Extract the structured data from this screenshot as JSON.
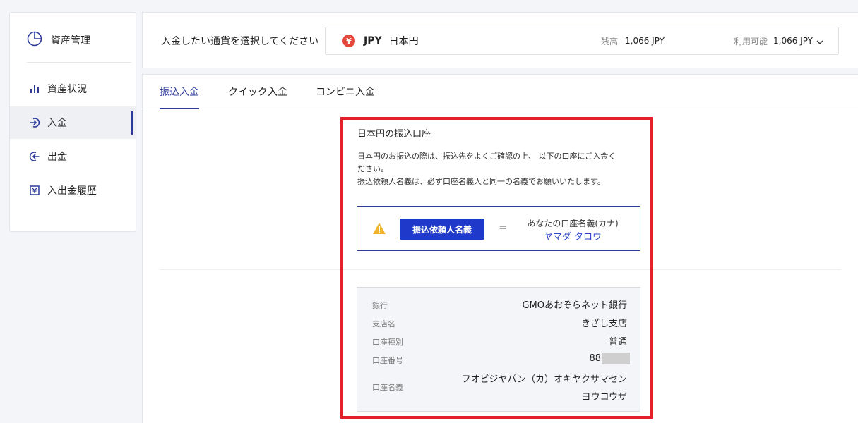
{
  "sidebar": {
    "title": "資産管理",
    "items": [
      {
        "label": "資産状況"
      },
      {
        "label": "入金"
      },
      {
        "label": "出金"
      },
      {
        "label": "入出金履歴"
      }
    ]
  },
  "currency": {
    "prompt": "入金したい通貨を選択してください",
    "badge": "¥",
    "code": "JPY",
    "name": "日本円",
    "balance_label": "残高",
    "balance_value": "1,066 JPY",
    "available_label": "利用可能",
    "available_value": "1,066 JPY"
  },
  "tabs": [
    {
      "label": "振込入金"
    },
    {
      "label": "クイック入金"
    },
    {
      "label": "コンビニ入金"
    }
  ],
  "deposit": {
    "title": "日本円の振込口座",
    "desc_line1": "日本円のお振込の際は、振込先をよくご確認の上、 以下の口座にご入金く",
    "desc_line2": "ださい。",
    "desc_line3": "振込依頼人名義は、必ず口座名義人と同一の名義でお願いいたします。",
    "sender_button": "振込依頼人名義",
    "equals": "=",
    "kana_label": "あなたの口座名義(カナ)",
    "kana_value": "ヤマダ タロウ"
  },
  "bank": {
    "bank_label": "銀行",
    "bank_value": "GMOあおぞらネット銀行",
    "branch_label": "支店名",
    "branch_value": "きざし支店",
    "type_label": "口座種別",
    "type_value": "普通",
    "number_label": "口座番号",
    "number_value": "88",
    "holder_label": "口座名義",
    "holder_line1": "フオビジヤパン（カ）オキヤクサマセン",
    "holder_line2": "ヨウコウザ"
  },
  "colors": {
    "accent": "#2d3b9a",
    "button": "#1f3aca",
    "highlight": "#e4202a",
    "warning": "#f0b429"
  }
}
